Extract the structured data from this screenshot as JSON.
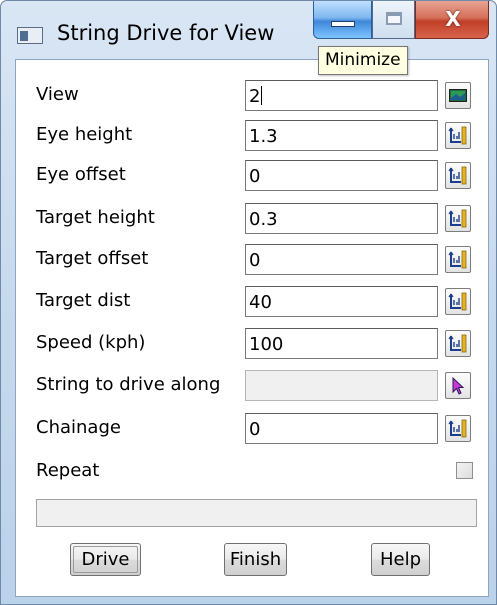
{
  "window": {
    "title": "String Drive for View"
  },
  "tooltip": {
    "text": "Minimize"
  },
  "fields": [
    {
      "label": "View",
      "value": "2",
      "button_icon": "view-icon"
    },
    {
      "label": "Eye height",
      "value": "1.3",
      "button_icon": "measure-icon"
    },
    {
      "label": "Eye offset",
      "value": "0",
      "button_icon": "measure-icon"
    },
    {
      "label": "Target height",
      "value": "0.3",
      "button_icon": "measure-icon"
    },
    {
      "label": "Target offset",
      "value": "0",
      "button_icon": "measure-icon"
    },
    {
      "label": "Target dist",
      "value": "40",
      "button_icon": "measure-icon"
    },
    {
      "label": "Speed (kph)",
      "value": "100",
      "button_icon": "measure-icon"
    },
    {
      "label": "String to drive along",
      "value": "",
      "button_icon": "pick-arrow-icon"
    },
    {
      "label": "Chainage",
      "value": "0",
      "button_icon": "measure-icon"
    }
  ],
  "repeat": {
    "label": "Repeat",
    "checked": false
  },
  "status": {
    "text": ""
  },
  "buttons": {
    "drive": "Drive",
    "finish": "Finish",
    "help": "Help"
  },
  "colors": {
    "title_gradient_top": "#d9e6f4",
    "close_button": "#c2402a",
    "minimize_button": "#3f86d9",
    "tooltip_bg": "#ffffe1"
  }
}
